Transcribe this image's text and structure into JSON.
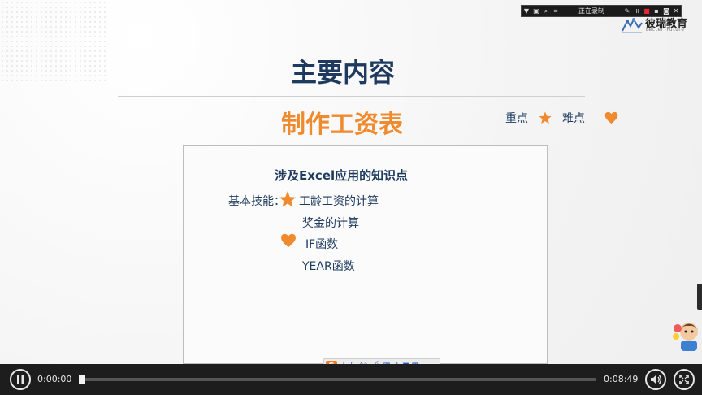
{
  "recorder": {
    "status": "正在录制"
  },
  "logo": {
    "name": "彼瑞教育",
    "tagline": "Better Future"
  },
  "slide": {
    "title": "主要内容",
    "subtitle": "制作工资表",
    "legend": {
      "key_point": "重点",
      "difficult_point": "难点"
    },
    "box": {
      "heading": "涉及Excel应用的知识点",
      "label": "基本技能：",
      "items": [
        "工龄工资的计算",
        "奖金的计算",
        "IF函数",
        "YEAR函数"
      ]
    }
  },
  "ime": {
    "brand": "S",
    "lang": "中"
  },
  "player": {
    "current_time": "0:00:00",
    "duration": "0:08:49",
    "progress": 0.0
  },
  "colors": {
    "accent_orange": "#ef8a2e",
    "title_navy": "#1e3a5f",
    "player_bg": "#1d1d1d"
  },
  "icons": {
    "key_point": "star-icon",
    "difficult_point": "heart-icon"
  }
}
